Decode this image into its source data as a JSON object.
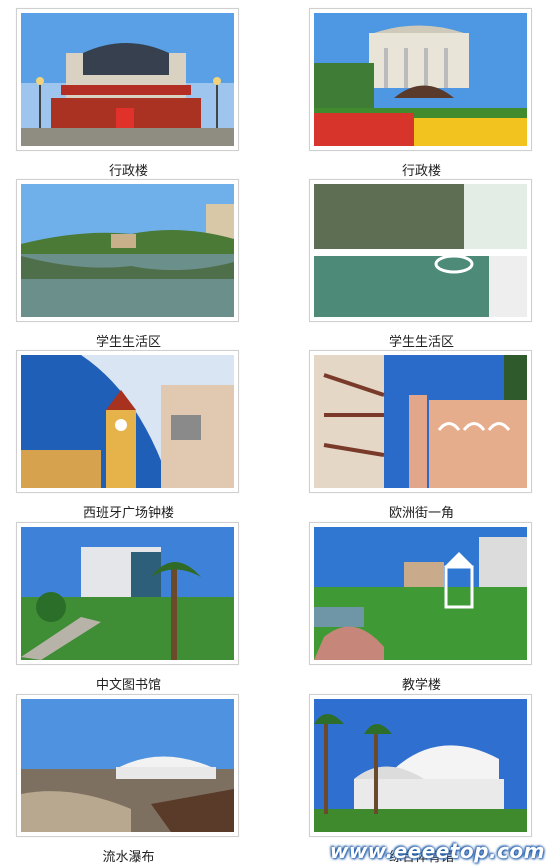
{
  "gallery": {
    "items": [
      {
        "caption": "行政楼"
      },
      {
        "caption": "行政楼"
      },
      {
        "caption": "学生生活区"
      },
      {
        "caption": "学生生活区"
      },
      {
        "caption": "西班牙广场钟楼"
      },
      {
        "caption": "欧洲街一角"
      },
      {
        "caption": "中文图书馆"
      },
      {
        "caption": "教学楼"
      },
      {
        "caption": "流水瀑布"
      },
      {
        "caption": "综合体育馆"
      }
    ]
  },
  "watermark": {
    "text": "www.eeeetop.com"
  }
}
